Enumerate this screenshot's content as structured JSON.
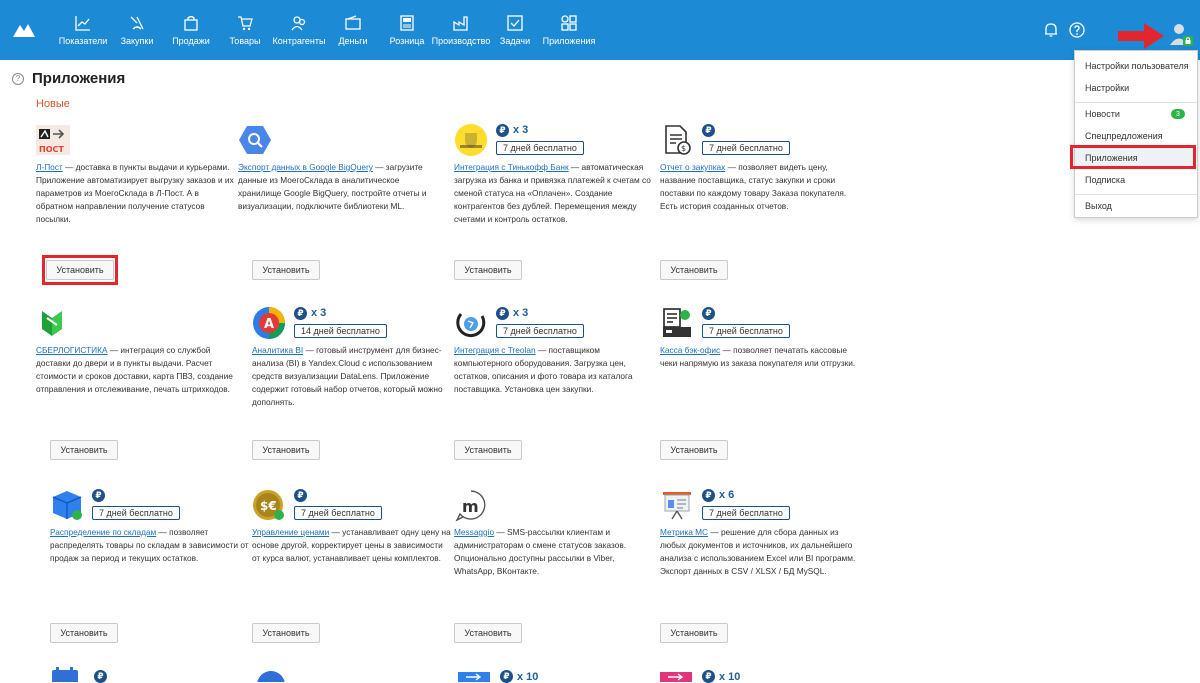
{
  "nav": {
    "items": [
      {
        "label": "Показатели",
        "icon": "chart-icon"
      },
      {
        "label": "Закупки",
        "icon": "purchases-icon"
      },
      {
        "label": "Продажи",
        "icon": "bag-icon"
      },
      {
        "label": "Товары",
        "icon": "cart-icon"
      },
      {
        "label": "Контрагенты",
        "icon": "people-icon"
      },
      {
        "label": "Деньги",
        "icon": "wallet-icon"
      },
      {
        "label": "Розница",
        "icon": "register-icon"
      },
      {
        "label": "Производство",
        "icon": "factory-icon"
      },
      {
        "label": "Задачи",
        "icon": "check-icon"
      },
      {
        "label": "Приложения",
        "icon": "apps-icon"
      }
    ]
  },
  "page": {
    "title": "Приложения",
    "section": "Новые"
  },
  "cards": [
    {
      "name": "Л-Пост",
      "text": " — доставка в пункты выдачи и курьерами. Приложение автоматизирует выгрузку заказов и их параметров из МоегоСклада в Л-Пост. А в обратном направлении получение статусов посылки.",
      "price": "",
      "trial": "",
      "button": "Установить",
      "logo_text": "ПОСТ"
    },
    {
      "name": "Экспорт данных в Google BigQuery",
      "text": " — загрузите данные из МоегоСклада в аналитическое хранилище Google BigQuery, постройте отчеты и визуализации, подключите библиотеки ML.",
      "price": "",
      "trial": "",
      "button": "Установить"
    },
    {
      "name": "Интеграция с Тинькофф Банк",
      "text": " — автоматическая загрузка из банка и привязка платежей к счетам со сменой статуса на «Оплачен». Создание контрагентов без дублей. Перемещения между счетами и контроль остатков.",
      "price": "x 3",
      "trial": "7 дней бесплатно",
      "button": "Установить"
    },
    {
      "name": "Отчет о закупках",
      "text": " — позволяет видеть цену, название поставщика, статус закупки и сроки поставки по каждому товару Заказа покупателя. Есть история созданных отчетов.",
      "price": "",
      "trial": "7 дней бесплатно",
      "button": "Установить"
    },
    {
      "name": "СБЕРЛОГИСТИКА",
      "text": " — интеграция со службой доставки до двери и в пункты выдачи. Расчет стоимости и сроков доставки, карта ПВЗ, создание отправления и отслеживание, печать штрихкодов.",
      "price": "",
      "trial": "",
      "button": "Установить"
    },
    {
      "name": "Аналитика BI",
      "text": " — готовый инструмент для бизнес-анализа (BI) в Yandex.Cloud с использованием средств визуализации DataLens. Приложение содержит готовый набор отчетов, который можно дополнять.",
      "price": "x 3",
      "trial": "14 дней бесплатно",
      "button": "Установить"
    },
    {
      "name": "Интеграция с Treolan",
      "text": " — поставщиком компьютерного оборудования. Загрузка цен, остатков, описания и фото товара из каталога поставщика. Установка цен закупки.",
      "price": "x 3",
      "trial": "7 дней бесплатно",
      "button": "Установить"
    },
    {
      "name": "Касса бэк-офис",
      "text": " — позволяет печатать кассовые чеки напрямую из заказа покупателя или отгрузки.",
      "price": "",
      "trial": "7 дней бесплатно",
      "button": "Установить"
    },
    {
      "name": "Распределение по складам",
      "text": " — позволяет распределять товары по складам в зависимости от продаж за период и текущих остатков.",
      "price": "",
      "trial": "7 дней бесплатно",
      "button": "Установить"
    },
    {
      "name": "Управление ценами",
      "text": " — устанавливает одну цену на основе другой, корректирует цены в зависимости от курса валют, устанавливает цены комплектов.",
      "price": "",
      "trial": "7 дней бесплатно",
      "button": "Установить"
    },
    {
      "name": "Messaggio",
      "text": " — SMS-рассылки клиентам и администраторам о смене статусов заказов. Опционально доступны рассылки в Viber, WhatsApp, ВКонтакте.",
      "price": "",
      "trial": "",
      "button": "Установить"
    },
    {
      "name": "Метрика МС",
      "text": " — решение для сбора данных из любых документов и источников, их дальнейшего анализа с использованием Excel или BI программ. Экспорт данных в CSV / XLSX / БД MySQL.",
      "price": "x 6",
      "trial": "7 дней бесплатно",
      "button": "Установить"
    }
  ],
  "bottom_prices": [
    "",
    "",
    "x 10",
    "x 10"
  ],
  "rub_symbol": "₽",
  "menu": {
    "items": [
      {
        "label": "Настройки пользователя"
      },
      {
        "label": "Настройки"
      },
      {
        "label": "Новости",
        "badge": "3"
      },
      {
        "label": "Спецпредложения"
      },
      {
        "label": "Приложения"
      },
      {
        "label": "Подписка"
      },
      {
        "label": "Выход"
      }
    ]
  },
  "colors": {
    "topbar": "#1d8ad6",
    "accent_red": "#e3262e",
    "link": "#1d6fc0",
    "section": "#e0552b"
  }
}
